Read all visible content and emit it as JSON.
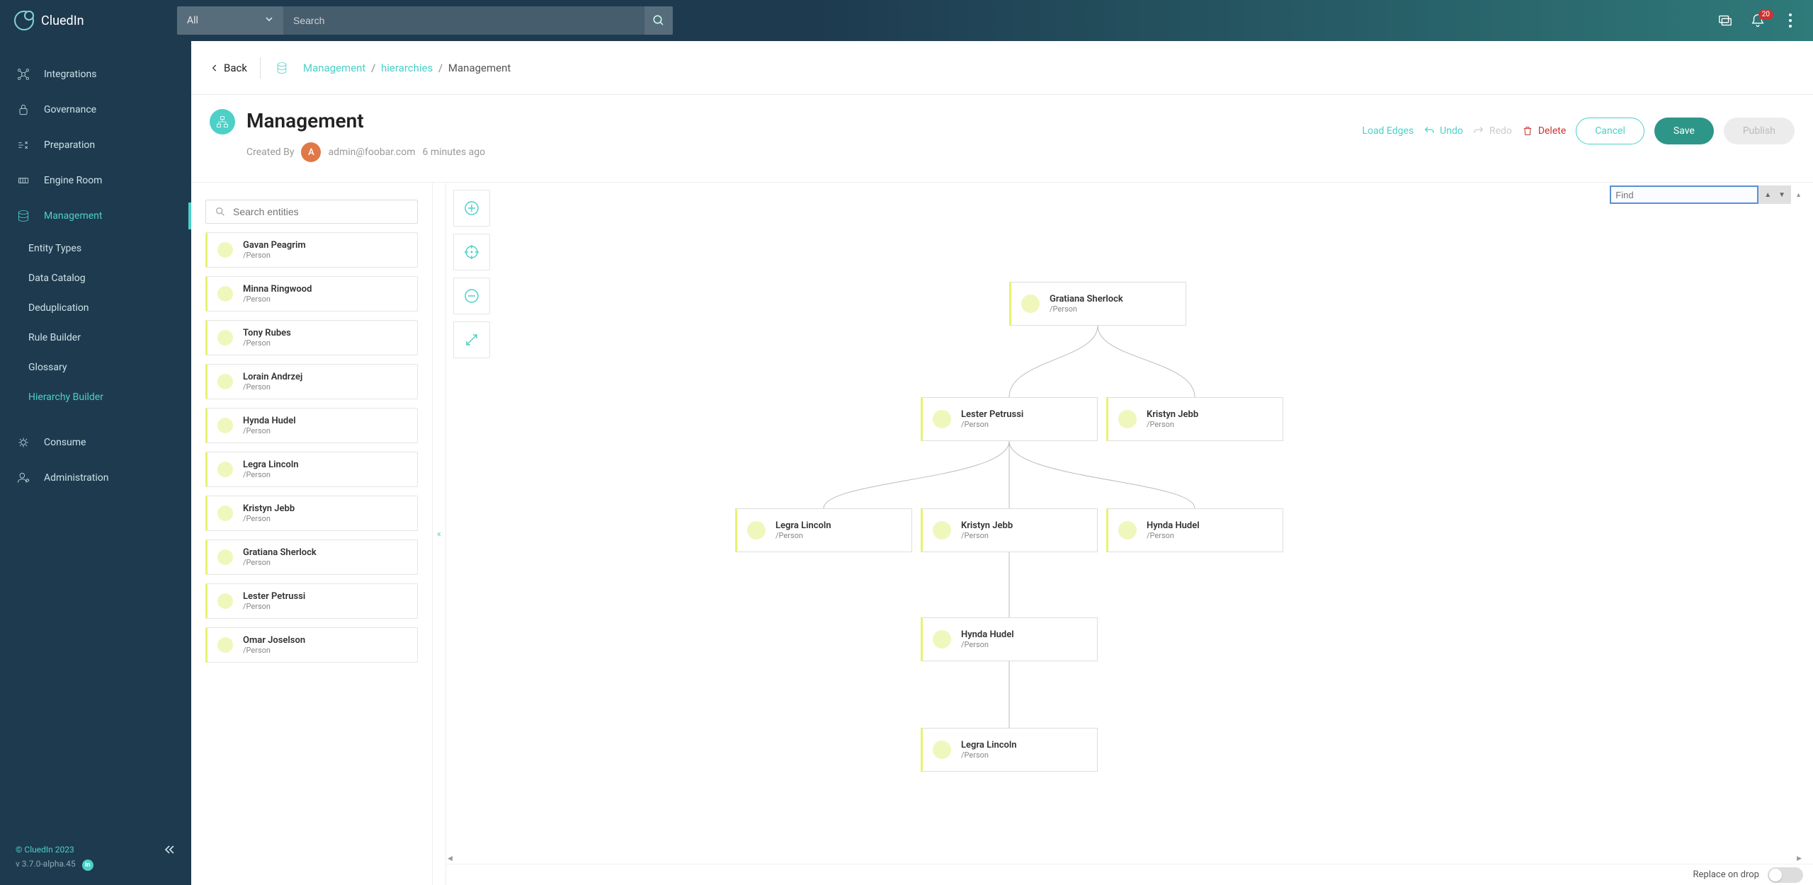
{
  "brand": {
    "name": "CluedIn"
  },
  "search": {
    "filter_label": "All",
    "placeholder": "Search"
  },
  "notifications": {
    "count": "20"
  },
  "sidebar": {
    "items": [
      {
        "label": "Integrations"
      },
      {
        "label": "Governance"
      },
      {
        "label": "Preparation"
      },
      {
        "label": "Engine Room"
      },
      {
        "label": "Management"
      }
    ],
    "sub_items": [
      {
        "label": "Entity Types"
      },
      {
        "label": "Data Catalog"
      },
      {
        "label": "Deduplication"
      },
      {
        "label": "Rule Builder"
      },
      {
        "label": "Glossary"
      },
      {
        "label": "Hierarchy Builder"
      }
    ],
    "bottom_items": [
      {
        "label": "Consume"
      },
      {
        "label": "Administration"
      }
    ],
    "copyright": "©  CluedIn  2023",
    "version": "v 3.7.0-alpha.45"
  },
  "breadcrumb": {
    "back": "Back",
    "root": "Management",
    "mid": "hierarchies",
    "current": "Management"
  },
  "page": {
    "title": "Management",
    "created_by_label": "Created By",
    "created_by_user": "admin@foobar.com",
    "created_ago": "6 minutes ago",
    "avatar_initial": "A"
  },
  "actions": {
    "load_edges": "Load Edges",
    "undo": "Undo",
    "redo": "Redo",
    "delete": "Delete",
    "cancel": "Cancel",
    "save": "Save",
    "publish": "Publish"
  },
  "entity_search_placeholder": "Search entities",
  "entities": [
    {
      "name": "Gavan Peagrim",
      "type": "/Person"
    },
    {
      "name": "Minna Ringwood",
      "type": "/Person"
    },
    {
      "name": "Tony Rubes",
      "type": "/Person"
    },
    {
      "name": "Lorain Andrzej",
      "type": "/Person"
    },
    {
      "name": "Hynda Hudel",
      "type": "/Person"
    },
    {
      "name": "Legra Lincoln",
      "type": "/Person"
    },
    {
      "name": "Kristyn Jebb",
      "type": "/Person"
    },
    {
      "name": "Gratiana Sherlock",
      "type": "/Person"
    },
    {
      "name": "Lester Petrussi",
      "type": "/Person"
    },
    {
      "name": "Omar Joselson",
      "type": "/Person"
    }
  ],
  "find_placeholder": "Find",
  "nodes": {
    "n0": {
      "name": "Gratiana Sherlock",
      "type": "/Person"
    },
    "n1": {
      "name": "Lester Petrussi",
      "type": "/Person"
    },
    "n2": {
      "name": "Kristyn Jebb",
      "type": "/Person"
    },
    "n3": {
      "name": "Legra Lincoln",
      "type": "/Person"
    },
    "n4": {
      "name": "Kristyn Jebb",
      "type": "/Person"
    },
    "n5": {
      "name": "Hynda Hudel",
      "type": "/Person"
    },
    "n6": {
      "name": "Hynda Hudel",
      "type": "/Person"
    },
    "n7": {
      "name": "Legra Lincoln",
      "type": "/Person"
    }
  },
  "footer": {
    "replace_label": "Replace on drop"
  }
}
